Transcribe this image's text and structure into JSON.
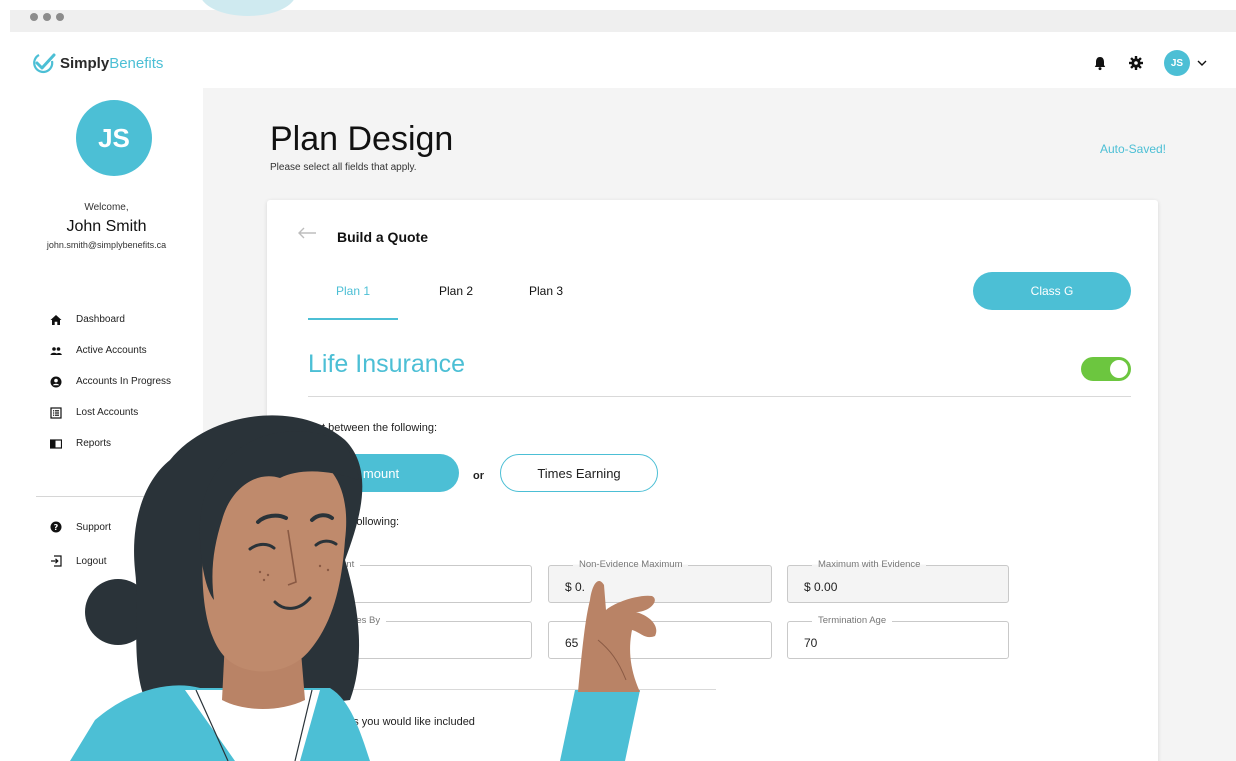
{
  "brand": {
    "part1": "Simply",
    "part2": "Benefits"
  },
  "header": {
    "avatar_initials": "JS"
  },
  "sidebar": {
    "avatar_initials": "JS",
    "welcome": "Welcome,",
    "user_name": "John Smith",
    "user_email": "john.smith@simplybenefits.ca",
    "items": [
      {
        "label": "Dashboard",
        "icon": "home-icon"
      },
      {
        "label": "Active Accounts",
        "icon": "people-icon"
      },
      {
        "label": "Accounts In Progress",
        "icon": "user-circle-icon"
      },
      {
        "label": "Lost Accounts",
        "icon": "list-icon"
      },
      {
        "label": "Reports",
        "icon": "book-icon"
      }
    ],
    "bottom_items": [
      {
        "label": "Support",
        "icon": "help-icon"
      },
      {
        "label": "Logout",
        "icon": "logout-icon"
      }
    ]
  },
  "page": {
    "title": "Plan Design",
    "subtitle": "Please select all fields that apply.",
    "autosave": "Auto-Saved!"
  },
  "card": {
    "title": "Build a Quote",
    "tabs": [
      "Plan 1",
      "Plan 2",
      "Plan 3"
    ],
    "active_tab": "Plan 1",
    "class_button": "Class G",
    "section_title": "Life Insurance",
    "section_enabled": true,
    "instruction1": "lect between the following:",
    "option1": "mount",
    "or": "or",
    "option2": "Times Earning",
    "instruction2": "plete the following:",
    "fields": {
      "amount": {
        "label": "unt",
        "value": ".00"
      },
      "non_evidence": {
        "label": "Non-Evidence Maximum",
        "value": "$ 0."
      },
      "max_evidence": {
        "label": "Maximum with Evidence",
        "value": "$ 0.00"
      },
      "reduces_by": {
        "label": "duces By",
        "value": ""
      },
      "reduction_age": {
        "label": "",
        "value": "65"
      },
      "termination_age": {
        "label": "Termination Age",
        "value": "70"
      }
    },
    "instruction3": "t the items you would like included"
  },
  "colors": {
    "accent": "#4cbfd5",
    "toggle_on": "#6cc63f"
  }
}
